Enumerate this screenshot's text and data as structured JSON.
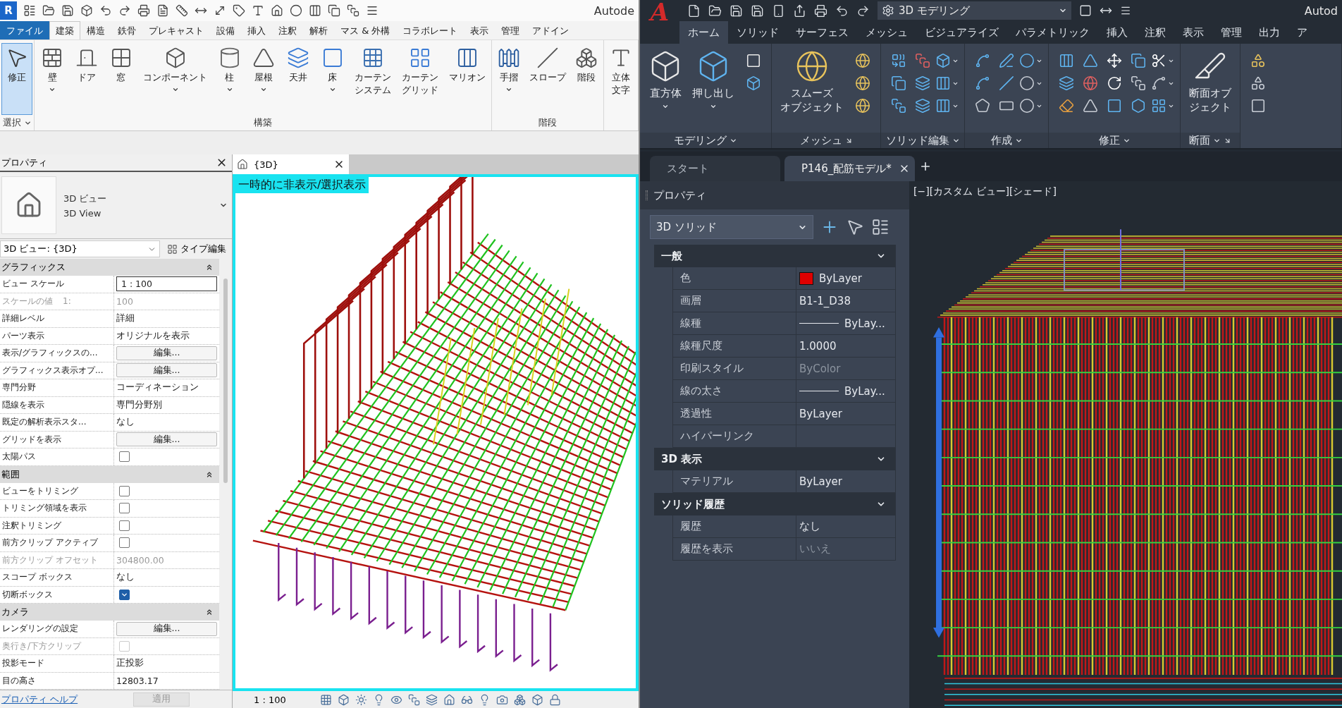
{
  "revit": {
    "logo": "R",
    "title_cut": "Autode",
    "tabs": [
      {
        "label": "ファイル",
        "kind": "file",
        "selected": false
      },
      {
        "label": "建築",
        "kind": "tab",
        "selected": true
      },
      {
        "label": "構造",
        "kind": "tab",
        "selected": false
      },
      {
        "label": "鉄骨",
        "kind": "tab",
        "selected": false
      },
      {
        "label": "プレキャスト",
        "kind": "tab",
        "selected": false
      },
      {
        "label": "設備",
        "kind": "tab",
        "selected": false
      },
      {
        "label": "挿入",
        "kind": "tab",
        "selected": false
      },
      {
        "label": "注釈",
        "kind": "tab",
        "selected": false
      },
      {
        "label": "解析",
        "kind": "tab",
        "selected": false
      },
      {
        "label": "マス & 外構",
        "kind": "tab",
        "selected": false
      },
      {
        "label": "コラボレート",
        "kind": "tab",
        "selected": false
      },
      {
        "label": "表示",
        "kind": "tab",
        "selected": false
      },
      {
        "label": "管理",
        "kind": "tab",
        "selected": false
      },
      {
        "label": "アドイン",
        "kind": "tab",
        "selected": false
      }
    ],
    "ribbon_panels": [
      {
        "title": "選択",
        "menu": true,
        "buttons": [
          {
            "label": "修正",
            "dropdown": false,
            "selected": true
          }
        ]
      },
      {
        "title": "構築",
        "menu": false,
        "buttons": [
          {
            "label": "壁",
            "dropdown": true,
            "selected": false
          },
          {
            "label": "ドア",
            "dropdown": false,
            "selected": false
          },
          {
            "label": "窓",
            "dropdown": false,
            "selected": false
          },
          {
            "label": "コンポーネント",
            "dropdown": true,
            "selected": false
          },
          {
            "label": "柱",
            "dropdown": true,
            "selected": false
          },
          {
            "label": "屋根",
            "dropdown": true,
            "selected": false
          },
          {
            "label": "天井",
            "dropdown": false,
            "selected": false
          },
          {
            "label": "床",
            "dropdown": true,
            "selected": false
          },
          {
            "lines": [
              "カーテン",
              "システム"
            ],
            "dropdown": false,
            "selected": false
          },
          {
            "lines": [
              "カーテン",
              "グリッド"
            ],
            "dropdown": false,
            "selected": false
          },
          {
            "label": "マリオン",
            "dropdown": false,
            "selected": false
          }
        ]
      },
      {
        "title": "階段",
        "menu": false,
        "buttons": [
          {
            "label": "手摺",
            "dropdown": true,
            "selected": false
          },
          {
            "label": "スロープ",
            "dropdown": false,
            "selected": false
          },
          {
            "label": "階段",
            "dropdown": false,
            "selected": false
          }
        ]
      },
      {
        "menu": false,
        "buttons": [
          {
            "lines": [
              "立体",
              "文字"
            ],
            "dropdown": false,
            "selected": false
          }
        ]
      }
    ],
    "properties": {
      "title": "プロパティ",
      "type_name": "3D ビュー",
      "type_name_en": "3D View",
      "instance": "3D ビュー: {3D}",
      "edit_type": "タイプ編集",
      "groups": [
        {
          "title": "グラフィックス",
          "expanded": true,
          "rows": [
            {
              "label": "ビュー スケール",
              "kind": "field",
              "value": "1 : 100",
              "disabled": false
            },
            {
              "label": "スケールの値",
              "note": "1:",
              "kind": "text",
              "value": "100",
              "disabled": true
            },
            {
              "label": "詳細レベル",
              "kind": "text",
              "value": "詳細",
              "disabled": false
            },
            {
              "label": "パーツ表示",
              "kind": "text",
              "value": "オリジナルを表示",
              "disabled": false
            },
            {
              "label": "表示/グラフィックスの...",
              "kind": "button",
              "value": "編集...",
              "disabled": false
            },
            {
              "label": "グラフィックス表示オプ...",
              "kind": "button",
              "value": "編集...",
              "disabled": false
            },
            {
              "label": "専門分野",
              "kind": "text",
              "value": "コーディネーション",
              "disabled": false
            },
            {
              "label": "隠線を表示",
              "kind": "text",
              "value": "専門分野別",
              "disabled": false
            },
            {
              "label": "既定の解析表示スタ...",
              "kind": "text",
              "value": "なし",
              "disabled": false
            },
            {
              "label": "グリッドを表示",
              "kind": "button",
              "value": "編集...",
              "disabled": false
            },
            {
              "label": "太陽パス",
              "kind": "checkbox",
              "checked": false,
              "disabled": false
            }
          ]
        },
        {
          "title": "範囲",
          "expanded": true,
          "rows": [
            {
              "label": "ビューをトリミング",
              "kind": "checkbox",
              "checked": false,
              "disabled": false
            },
            {
              "label": "トリミング領域を表示",
              "kind": "checkbox",
              "checked": false,
              "disabled": false
            },
            {
              "label": "注釈トリミング",
              "kind": "checkbox",
              "checked": false,
              "disabled": false
            },
            {
              "label": "前方クリップ アクティブ",
              "kind": "checkbox",
              "checked": false,
              "disabled": false
            },
            {
              "label": "前方クリップ オフセット",
              "kind": "text",
              "value": "304800.00",
              "disabled": true
            },
            {
              "label": "スコープ ボックス",
              "kind": "text",
              "value": "なし",
              "disabled": false
            },
            {
              "label": "切断ボックス",
              "kind": "checkbox",
              "checked": true,
              "disabled": false
            }
          ]
        },
        {
          "title": "カメラ",
          "expanded": true,
          "rows": [
            {
              "label": "レンダリングの設定",
              "kind": "button",
              "value": "編集...",
              "disabled": false
            },
            {
              "label": "奥行き/下方クリップ",
              "kind": "checkbox",
              "checked": false,
              "disabled": true
            },
            {
              "label": "投影モード",
              "kind": "text",
              "value": "正投影",
              "disabled": false
            },
            {
              "label": "目の高さ",
              "kind": "text",
              "value": "12803.17",
              "disabled": false
            }
          ]
        }
      ],
      "help": "プロパティ ヘルプ",
      "apply": "適用"
    },
    "view": {
      "tab": "{3D}",
      "banner": "一時的に非表示/選択表示",
      "scale": "1 : 100"
    }
  },
  "autocad": {
    "logo": "A",
    "workspace": "3D モデリング",
    "title_cut": "Autod",
    "tabs": [
      {
        "label": "ホーム",
        "selected": true
      },
      {
        "label": "ソリッド",
        "selected": false
      },
      {
        "label": "サーフェス",
        "selected": false
      },
      {
        "label": "メッシュ",
        "selected": false
      },
      {
        "label": "ビジュアライズ",
        "selected": false
      },
      {
        "label": "パラメトリック",
        "selected": false
      },
      {
        "label": "挿入",
        "selected": false
      },
      {
        "label": "注釈",
        "selected": false
      },
      {
        "label": "表示",
        "selected": false
      },
      {
        "label": "管理",
        "selected": false
      },
      {
        "label": "出力",
        "selected": false
      },
      {
        "label": "ア",
        "selected": false
      }
    ],
    "ribbon_panels": [
      {
        "title": "モデリング",
        "menu": true,
        "launcher": false,
        "buttons": [
          {
            "label": "直方体",
            "dropdown": true
          },
          {
            "label": "押し出し",
            "dropdown": true
          }
        ]
      },
      {
        "title": "メッシュ",
        "menu": false,
        "launcher": true,
        "buttons": [
          {
            "lines": [
              "スムーズ",
              "オブジェクト"
            ],
            "dropdown": false
          }
        ]
      },
      {
        "title": "ソリッド編集",
        "menu": true,
        "launcher": false
      },
      {
        "title": "作成",
        "menu": true,
        "launcher": false
      },
      {
        "title": "修正",
        "menu": true,
        "launcher": false
      },
      {
        "title": "断面",
        "menu": true,
        "launcher": true,
        "buttons": [
          {
            "lines": [
              "断面オブ",
              "ジェクト"
            ],
            "dropdown": false
          }
        ]
      },
      {
        "menu": false,
        "launcher": false
      }
    ],
    "files": [
      {
        "label": "スタート",
        "selected": false,
        "closable": false
      },
      {
        "label": "P146_配筋モデル*",
        "selected": true,
        "closable": true
      }
    ],
    "properties": {
      "title": "プロパティ",
      "selection": "3D ソリッド",
      "groups": [
        {
          "title": "一般",
          "expanded": true,
          "rows": [
            {
              "label": "色",
              "kind": "color",
              "color": "#e00000",
              "value": "ByLayer",
              "disabled": false
            },
            {
              "label": "画層",
              "kind": "text",
              "value": "B1-1_D38",
              "disabled": false
            },
            {
              "label": "線種",
              "kind": "linetype",
              "value": "ByLay...",
              "disabled": false
            },
            {
              "label": "線種尺度",
              "kind": "text",
              "value": "1.0000",
              "disabled": false
            },
            {
              "label": "印刷スタイル",
              "kind": "text",
              "value": "ByColor",
              "disabled": true
            },
            {
              "label": "線の太さ",
              "kind": "linetype",
              "value": "ByLay...",
              "disabled": false
            },
            {
              "label": "透過性",
              "kind": "text",
              "value": "ByLayer",
              "disabled": false
            },
            {
              "label": "ハイパーリンク",
              "kind": "text",
              "disabled": false
            }
          ]
        },
        {
          "title": "3D 表示",
          "expanded": true,
          "rows": [
            {
              "label": "マテリアル",
              "kind": "text",
              "value": "ByLayer",
              "disabled": false
            }
          ]
        },
        {
          "title": "ソリッド履歴",
          "expanded": true,
          "rows": [
            {
              "label": "履歴",
              "kind": "text",
              "value": "なし",
              "disabled": false
            },
            {
              "label": "履歴を表示",
              "kind": "text",
              "value": "いいえ",
              "disabled": true
            }
          ]
        }
      ]
    },
    "viewport_label": "[−][カスタム ビュー][シェード]"
  }
}
